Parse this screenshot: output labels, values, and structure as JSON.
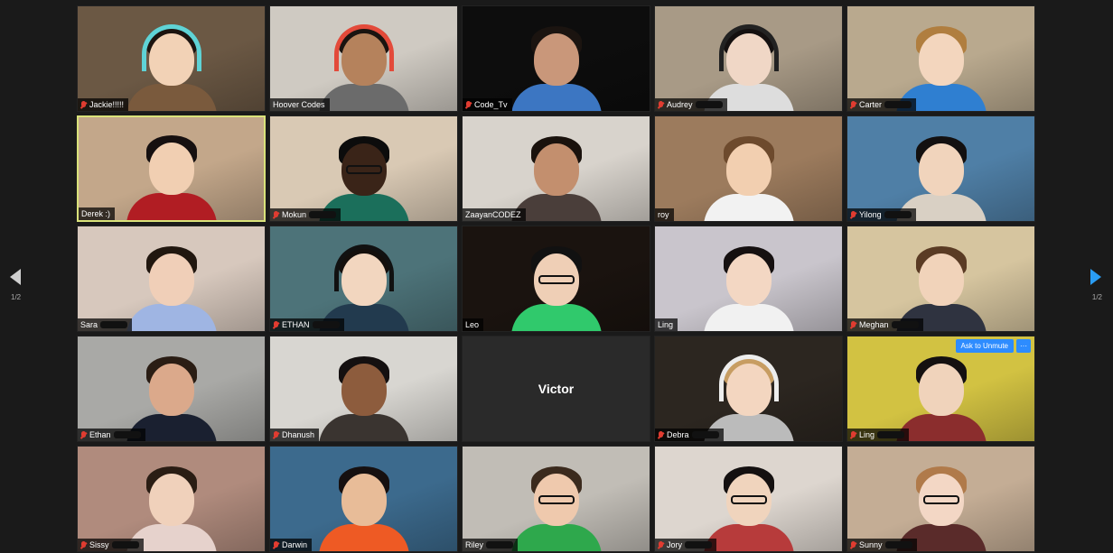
{
  "navigation": {
    "left_page_label": "1/2",
    "right_page_label": "1/2"
  },
  "tiles": [
    {
      "name": "Jackie!!!!!",
      "muted": true,
      "redacted": false,
      "bg": "#6b5844",
      "skin": "#f2d2b6",
      "hair": "#1c1410",
      "shirt": "#7a5a3d",
      "headphones": true,
      "hpColor": "#5fd3d6"
    },
    {
      "name": "Hoover Codes",
      "muted": false,
      "redacted": false,
      "bg": "#cfcac2",
      "skin": "#b5825c",
      "hair": "#1a1410",
      "shirt": "#6b6b6b",
      "headphones": true,
      "hpColor": "#e34a3a"
    },
    {
      "name": "Code_Tv",
      "muted": true,
      "redacted": false,
      "bg": "#0d0d0d",
      "skin": "#c9977a",
      "hair": "#1b1410",
      "shirt": "#3c76c2"
    },
    {
      "name": "Audrey",
      "muted": true,
      "redacted": true,
      "bg": "#a89a86",
      "skin": "#f0d7c6",
      "hair": "#141010",
      "shirt": "#dddddd",
      "headphones": true,
      "hpColor": "#222222"
    },
    {
      "name": "Carter",
      "muted": true,
      "redacted": true,
      "bg": "#b9a98e",
      "skin": "#f3d6be",
      "hair": "#b07e3f",
      "shirt": "#2f7fd1"
    },
    {
      "name": "Derek :)",
      "muted": false,
      "redacted": false,
      "bg": "#c3a78a",
      "skin": "#f1cfb2",
      "hair": "#161010",
      "shirt": "#b11d23",
      "active": true
    },
    {
      "name": "Mokun",
      "muted": true,
      "redacted": true,
      "bg": "#d9c9b4",
      "skin": "#3a2418",
      "hair": "#0c0c0c",
      "shirt": "#1b6f5b",
      "glasses": true
    },
    {
      "name": "ZaayanCODEZ",
      "muted": false,
      "redacted": false,
      "bg": "#d8d3cc",
      "skin": "#c38f6e",
      "hair": "#1a120d",
      "shirt": "#4a3e3a"
    },
    {
      "name": "roy",
      "muted": false,
      "redacted": false,
      "bg": "#9c7b5d",
      "skin": "#f2cfb0",
      "hair": "#6d4a2d",
      "shirt": "#f2f2f2"
    },
    {
      "name": "Yilong",
      "muted": true,
      "redacted": true,
      "bg": "#4f7fa6",
      "skin": "#f1d4bc",
      "hair": "#131010",
      "shirt": "#d9d0c4"
    },
    {
      "name": "Sara",
      "muted": false,
      "redacted": true,
      "bg": "#d7c8bd",
      "skin": "#f0cfb8",
      "hair": "#21170f",
      "shirt": "#9fb5e3"
    },
    {
      "name": "ETHAN",
      "muted": true,
      "redacted": true,
      "bg": "#4d7379",
      "skin": "#f2d6bf",
      "hair": "#140f0c",
      "shirt": "#223a4e",
      "headphones": true,
      "hpColor": "#111111"
    },
    {
      "name": "Leo",
      "muted": false,
      "redacted": false,
      "bg": "#1a130f",
      "skin": "#efcfb6",
      "hair": "#111111",
      "shirt": "#30c96c",
      "glasses": true
    },
    {
      "name": "Ling",
      "muted": false,
      "redacted": false,
      "bg": "#c9c5cc",
      "skin": "#f3d7c3",
      "hair": "#151010",
      "shirt": "#f1f1f1"
    },
    {
      "name": "Meghan",
      "muted": true,
      "redacted": true,
      "bg": "#d6c59f",
      "skin": "#f1d3ba",
      "hair": "#5a3b24",
      "shirt": "#2f3340"
    },
    {
      "name": "Ethan",
      "muted": true,
      "redacted": true,
      "bg": "#a9a9a6",
      "skin": "#dba98b",
      "hair": "#2a1d14",
      "shirt": "#1a2030"
    },
    {
      "name": "Dhanush",
      "muted": true,
      "redacted": false,
      "bg": "#d8d6d1",
      "skin": "#8d5c3d",
      "hair": "#141010",
      "shirt": "#3a3430"
    },
    {
      "name": "",
      "blank": true,
      "blank_name": "Victor"
    },
    {
      "name": "Debra",
      "muted": true,
      "redacted": true,
      "bg": "#2c2620",
      "skin": "#f3d6c0",
      "hair": "#c79d62",
      "shirt": "#bbbbbb",
      "headphones": true,
      "hpColor": "#ededed"
    },
    {
      "name": "Ling",
      "muted": true,
      "redacted": true,
      "bg": "#d2c242",
      "skin": "#f0d3bb",
      "hair": "#141010",
      "shirt": "#8b2d2d",
      "unmute": true
    },
    {
      "name": "Sissy",
      "muted": true,
      "redacted": true,
      "bg": "#b08b7d",
      "skin": "#f0d1bb",
      "hair": "#2a1d14",
      "shirt": "#e6d2cc"
    },
    {
      "name": "Darwin",
      "muted": true,
      "redacted": false,
      "bg": "#3c6a8d",
      "skin": "#e8bc98",
      "hair": "#161010",
      "shirt": "#ee5a24"
    },
    {
      "name": "Riley",
      "muted": false,
      "redacted": true,
      "bg": "#c1bdb6",
      "skin": "#efc9ad",
      "hair": "#3b2a1d",
      "shirt": "#2ea84c",
      "glasses": true
    },
    {
      "name": "Jory",
      "muted": true,
      "redacted": true,
      "bg": "#ddd6cf",
      "skin": "#f0d4bd",
      "hair": "#141010",
      "shirt": "#b73b3b",
      "glasses": true
    },
    {
      "name": "Sunny",
      "muted": true,
      "redacted": true,
      "bg": "#c4ad95",
      "skin": "#f3d7c5",
      "hair": "#b07a4a",
      "shirt": "#5a2b2a",
      "glasses": true
    }
  ],
  "unmute": {
    "label": "Ask to Unmute",
    "more": "···"
  }
}
